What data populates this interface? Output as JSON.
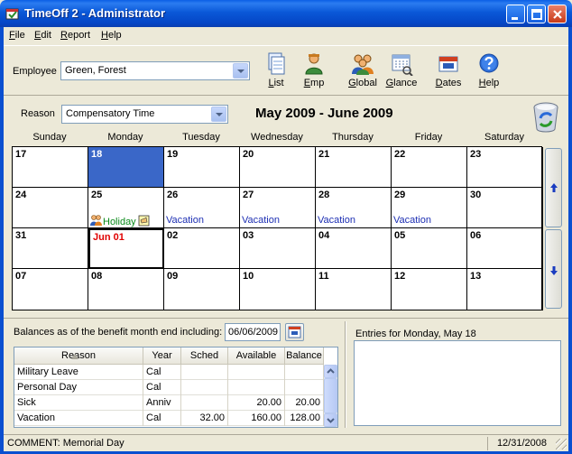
{
  "window": {
    "title": "TimeOff 2 - Administrator"
  },
  "menu": [
    "File",
    "Edit",
    "Report",
    "Help"
  ],
  "toolbar": {
    "employee_label": "Employee",
    "employee_value": "Green, Forest",
    "buttons": [
      {
        "label": "List",
        "icon": "list-icon"
      },
      {
        "label": "Emp",
        "icon": "employee-icon"
      },
      {
        "label": "Global",
        "icon": "global-group-icon"
      },
      {
        "label": "Glance",
        "icon": "glance-icon"
      },
      {
        "label": "Dates",
        "icon": "dates-icon"
      },
      {
        "label": "Help",
        "icon": "help-icon"
      }
    ]
  },
  "reason": {
    "label": "Reason",
    "value": "Compensatory Time"
  },
  "range_title": "May 2009 - June 2009",
  "calendar": {
    "day_headers": [
      "Sunday",
      "Monday",
      "Tuesday",
      "Wednesday",
      "Thursday",
      "Friday",
      "Saturday"
    ],
    "weeks": [
      [
        {
          "d": "17"
        },
        {
          "d": "18",
          "selected": true
        },
        {
          "d": "19"
        },
        {
          "d": "20"
        },
        {
          "d": "21"
        },
        {
          "d": "22"
        },
        {
          "d": "23"
        }
      ],
      [
        {
          "d": "24"
        },
        {
          "d": "25",
          "entry": "Holiday",
          "holiday": true
        },
        {
          "d": "26",
          "entry": "Vacation"
        },
        {
          "d": "27",
          "entry": "Vacation"
        },
        {
          "d": "28",
          "entry": "Vacation"
        },
        {
          "d": "29",
          "entry": "Vacation"
        },
        {
          "d": "30"
        }
      ],
      [
        {
          "d": "31"
        },
        {
          "d": "Jun 01",
          "red": true,
          "today": true
        },
        {
          "d": "02"
        },
        {
          "d": "03"
        },
        {
          "d": "04"
        },
        {
          "d": "05"
        },
        {
          "d": "06"
        }
      ],
      [
        {
          "d": "07"
        },
        {
          "d": "08"
        },
        {
          "d": "09"
        },
        {
          "d": "10"
        },
        {
          "d": "11"
        },
        {
          "d": "12"
        },
        {
          "d": "13"
        }
      ]
    ]
  },
  "balances": {
    "label": "Balances as of the benefit month end including:",
    "date": "06/06/2009",
    "columns": [
      "Reason",
      "Year",
      "Sched",
      "Available",
      "Balance"
    ],
    "rows": [
      [
        "Military Leave",
        "Cal",
        "",
        "",
        ""
      ],
      [
        "Personal Day",
        "Cal",
        "",
        "",
        ""
      ],
      [
        "Sick",
        "Anniv",
        "",
        "20.00",
        "20.00"
      ],
      [
        "Vacation",
        "Cal",
        "32.00",
        "160.00",
        "128.00"
      ]
    ]
  },
  "entries": {
    "label": "Entries for Monday,  May 18"
  },
  "status": {
    "comment": "COMMENT: Memorial Day",
    "date": "12/31/2008"
  }
}
